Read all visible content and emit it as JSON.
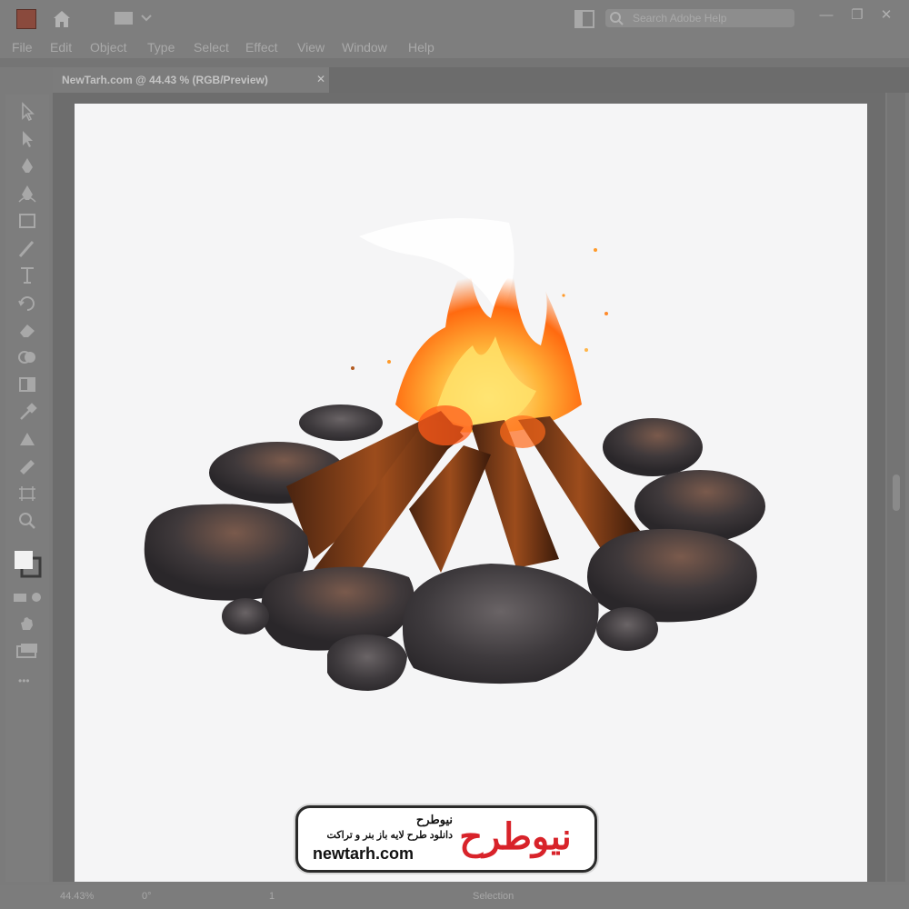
{
  "window": {
    "search_placeholder": "Search Adobe Help",
    "minimize_glyph": "—",
    "maximize_glyph": "❐",
    "close_glyph": "✕",
    "icons": [
      "app-icon",
      "home-icon",
      "workspace-icon",
      "chevron-down-icon",
      "arrange-documents-icon",
      "search-icon"
    ]
  },
  "menu": {
    "items": [
      "File",
      "Edit",
      "Object",
      "Type",
      "Select",
      "Effect",
      "View",
      "Window",
      "Help"
    ]
  },
  "document": {
    "tab_label": "NewTarh.com @ 44.43 % (RGB/Preview)",
    "close_glyph": "✕"
  },
  "toolbar": {
    "tools": [
      "selection-tool-icon",
      "direct-selection-tool-icon",
      "pen-tool-icon",
      "curvature-tool-icon",
      "rectangle-tool-icon",
      "paintbrush-tool-icon",
      "type-tool-icon",
      "rotate-tool-icon",
      "eraser-tool-icon",
      "shape-builder-tool-icon",
      "gradient-tool-icon",
      "eyedropper-tool-icon",
      "blend-tool-icon",
      "symbol-sprayer-tool-icon",
      "artboard-tool-icon",
      "zoom-tool-icon"
    ],
    "more_glyph": "•••"
  },
  "status": {
    "zoom": "44.43%",
    "rotation": "0°",
    "artboard": "1",
    "mode": "Selection"
  },
  "watermark": {
    "brand_fa": "نیوطرح",
    "tagline_fa": "دانلود طرح لایه باز بنر و تراکت",
    "url": "newtarh.com",
    "logo_fa": "نیوطرح"
  },
  "colors": {
    "chrome": "#7e7e7e",
    "artboard": "#f5f5f6",
    "logo_red": "#d8232a",
    "flame": "#ff8a1e"
  }
}
